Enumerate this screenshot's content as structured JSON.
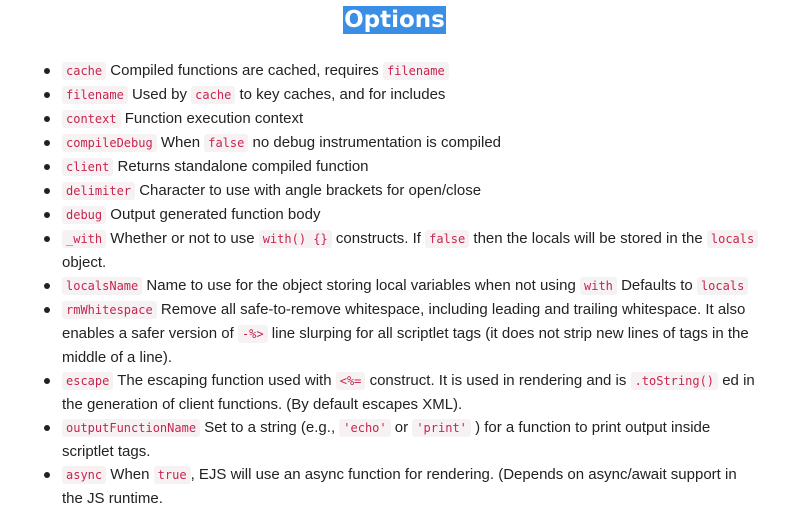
{
  "title": "Options",
  "options": [
    {
      "key": "cache",
      "desc1": " Compiled functions are cached, requires ",
      "code2": "filename"
    },
    {
      "key": "filename",
      "desc1": " Used by ",
      "code2": "cache",
      "desc2": " to key caches, and for includes"
    },
    {
      "key": "context",
      "desc1": " Function execution context"
    },
    {
      "key": "compileDebug",
      "desc1": " When ",
      "code2": "false",
      "desc2": " no debug instrumentation is compiled"
    },
    {
      "key": "client",
      "desc1": " Returns standalone compiled function"
    },
    {
      "key": "delimiter",
      "desc1": " Character to use with angle brackets for open/close"
    },
    {
      "key": "debug",
      "desc1": " Output generated function body"
    },
    {
      "key": "_with",
      "desc1": " Whether or not to use ",
      "code2": "with() {}",
      "desc2": " constructs. If ",
      "code3": "false",
      "desc3": " then the locals will be stored in the ",
      "code4": "locals",
      "desc4": " object."
    },
    {
      "key": "localsName",
      "desc1": " Name to use for the object storing local variables when not using ",
      "code2": "with",
      "desc2": " Defaults to ",
      "code3": "locals"
    },
    {
      "key": "rmWhitespace",
      "desc1": " Remove all safe-to-remove whitespace, including leading and trailing whitespace. It also enables a safer version of ",
      "code2": "-%>",
      "desc2": " line slurping for all scriptlet tags (it does not strip new lines of tags in the middle of a line)."
    },
    {
      "key": "escape",
      "desc1": " The escaping function used with ",
      "code2": "<%=",
      "desc2": " construct. It is used in rendering and is ",
      "code3": ".toString()",
      "desc3": " ed in the generation of client functions. (By default escapes XML)."
    },
    {
      "key": "outputFunctionName",
      "desc1": " Set to a string (e.g., ",
      "code2": "'echo'",
      "desc2": " or ",
      "code3": "'print'",
      "desc3": " ) for a function to print output inside scriptlet tags."
    },
    {
      "key": "async",
      "desc1": " When ",
      "code2": "true",
      "desc2": ", EJS will use an async function for rendering. (Depends on async/await support in the JS runtime."
    }
  ]
}
